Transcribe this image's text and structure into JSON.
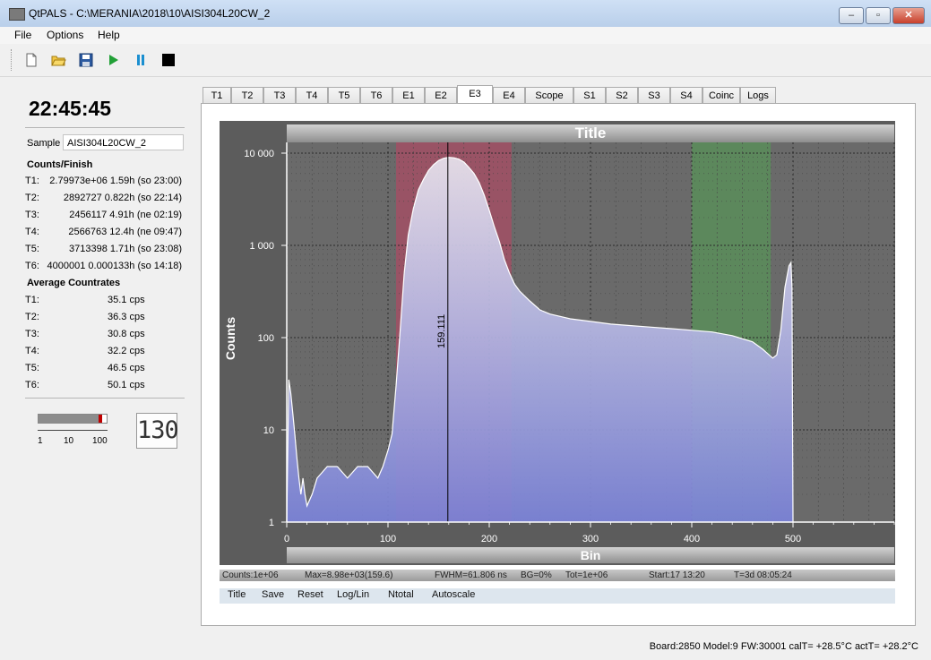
{
  "window": {
    "title": "QtPALS - C:\\MERANIA\\2018\\10\\AISI304L20CW_2",
    "min": "‒",
    "max": "▫",
    "close": "✕"
  },
  "menu": [
    "File",
    "Options",
    "Help"
  ],
  "toolbar_icons": [
    "new-icon",
    "open-icon",
    "save-icon",
    "start-icon",
    "pause-icon",
    "stop-icon"
  ],
  "left": {
    "clock": "22:45:45",
    "sample_label": "Sample",
    "sample_value": "AISI304L20CW_2",
    "counts_head": "Counts/Finish",
    "counts": [
      {
        "k": "T1:",
        "v": "2.79973e+06  1.59h (so 23:00)"
      },
      {
        "k": "T2:",
        "v": "2892727  0.822h (so 22:14)"
      },
      {
        "k": "T3:",
        "v": "2456117  4.91h (ne 02:19)"
      },
      {
        "k": "T4:",
        "v": "2566763  12.4h (ne 09:47)"
      },
      {
        "k": "T5:",
        "v": "3713398  1.71h (so 23:08)"
      },
      {
        "k": "T6:",
        "v": "4000001  0.000133h (so 14:18)"
      }
    ],
    "rates_head": "Average Countrates",
    "rates": [
      {
        "k": "T1:",
        "v": "35.1 cps"
      },
      {
        "k": "T2:",
        "v": "36.3 cps"
      },
      {
        "k": "T3:",
        "v": "30.8 cps"
      },
      {
        "k": "T4:",
        "v": "32.2 cps"
      },
      {
        "k": "T5:",
        "v": "46.5 cps"
      },
      {
        "k": "T6:",
        "v": "50.1 cps"
      }
    ],
    "rate_scale": [
      "1",
      "10",
      "100"
    ],
    "rate_level_fraction": 0.94,
    "lcd": "130"
  },
  "tabs": [
    "T1",
    "T2",
    "T3",
    "T4",
    "T5",
    "T6",
    "E1",
    "E2",
    "E3",
    "E4",
    "Scope",
    "S1",
    "S2",
    "S3",
    "S4",
    "Coinc",
    "Logs"
  ],
  "active_tab": "E3",
  "chart_data": {
    "type": "area",
    "title": "Title",
    "xlabel": "Bin",
    "ylabel": "Counts",
    "xlim": [
      0,
      600
    ],
    "ylim": [
      1,
      10000
    ],
    "y_scale": "log",
    "x_ticks": [
      "0",
      "100",
      "200",
      "300",
      "400",
      "500"
    ],
    "y_ticks": [
      "1",
      "10",
      "100",
      "1 000",
      "10 000"
    ],
    "marker_x": 159.111,
    "marker_label": "159.111",
    "regions": [
      {
        "from": 108,
        "to": 222,
        "color": "#c04060"
      },
      {
        "from": 400,
        "to": 478,
        "color": "#50a050"
      }
    ],
    "x": [
      0,
      2,
      4,
      6,
      8,
      10,
      12,
      14,
      16,
      18,
      20,
      25,
      30,
      40,
      50,
      60,
      70,
      80,
      90,
      95,
      100,
      104,
      108,
      112,
      116,
      120,
      125,
      130,
      135,
      140,
      145,
      150,
      155,
      160,
      165,
      170,
      175,
      180,
      185,
      190,
      195,
      200,
      205,
      210,
      215,
      220,
      225,
      230,
      240,
      250,
      260,
      270,
      280,
      300,
      320,
      340,
      360,
      380,
      400,
      420,
      440,
      460,
      470,
      480,
      484,
      488,
      492,
      496,
      498,
      499,
      500
    ],
    "y": [
      1,
      35,
      25,
      15,
      9,
      5,
      3,
      2,
      3,
      2,
      1.5,
      2,
      3,
      4,
      4,
      3,
      4,
      4,
      3,
      4,
      6,
      9,
      30,
      120,
      500,
      1300,
      2500,
      4000,
      5200,
      6500,
      7500,
      8300,
      8800,
      9000,
      8900,
      8600,
      8000,
      7000,
      6000,
      4800,
      3500,
      2400,
      1600,
      1100,
      700,
      500,
      380,
      320,
      250,
      200,
      180,
      170,
      160,
      150,
      140,
      135,
      130,
      125,
      120,
      115,
      105,
      90,
      75,
      60,
      65,
      120,
      350,
      600,
      650,
      350,
      1
    ]
  },
  "status_line": {
    "counts": "Counts:1e+06",
    "max": "Max=8.98e+03(159.6)",
    "fwhm": "FWHM=61.806 ns",
    "bg": "BG=0%",
    "tot": "Tot=1e+06",
    "start": "Start:17 13:20",
    "t": "T=3d 08:05:24"
  },
  "plot_buttons": [
    "Title",
    "Save",
    "Reset",
    "Log/Lin",
    "Ntotal",
    "Autoscale"
  ],
  "statusbar": "Board:2850 Model:9 FW:30001 calT= +28.5°C actT= +28.2°C",
  "colors": {
    "fill_top": "#e8e4ee",
    "fill_bottom": "#7a82d8",
    "plot_bg": "#6a6a6a"
  }
}
